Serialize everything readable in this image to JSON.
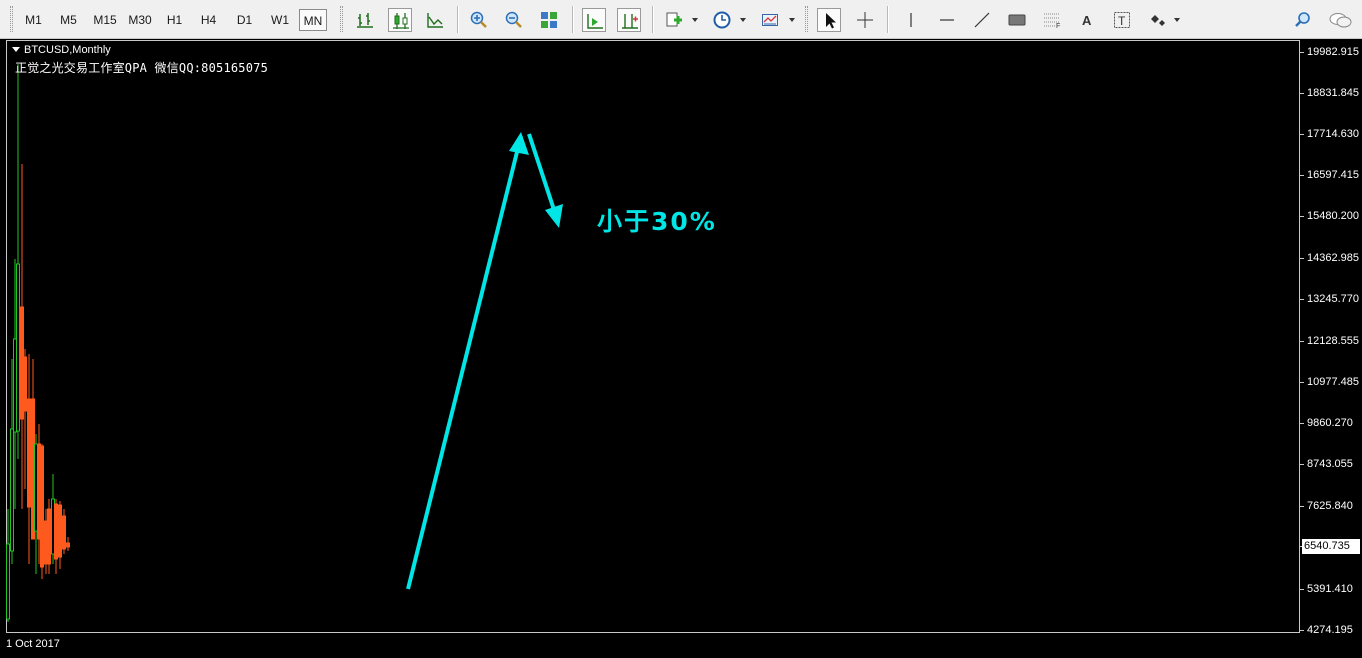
{
  "toolbar": {
    "timeframes": [
      "M1",
      "M5",
      "M15",
      "M30",
      "H1",
      "H4",
      "D1",
      "W1",
      "MN"
    ],
    "active_timeframe": "MN",
    "icons": {
      "bar_chart": "bar-chart-icon",
      "candlesticks": "candlestick-chart-icon",
      "line_chart": "line-chart-icon",
      "zoom_in": "zoom-in-icon",
      "zoom_out": "zoom-out-icon",
      "tile_windows": "tile-windows-icon",
      "auto_scroll": "auto-scroll-icon",
      "chart_shift": "chart-shift-icon",
      "indicators": "indicators-icon",
      "periodicity": "clock-icon",
      "templates": "templates-icon",
      "cursor": "cursor-icon",
      "crosshair": "crosshair-icon",
      "vertical_line": "vertical-line-icon",
      "horizontal_line": "horizontal-line-icon",
      "trendline": "trendline-icon",
      "rectangle": "rectangle-icon",
      "fibonacci": "fibonacci-icon",
      "text": "text-icon",
      "text_label": "text-label-icon",
      "arrows": "arrows-icon",
      "search": "search-icon",
      "chat": "chat-icon"
    },
    "text_tool_label": "A",
    "text_label_tool_label": "T"
  },
  "chart": {
    "title": "BTCUSD,Monthly",
    "indicator_text": "正觉之光交易工作室QPA 微信QQ:805165075",
    "annotation": "小于30%",
    "date_label": "1 Oct 2017",
    "current_price": "6540.735",
    "price_labels": [
      "19982.915",
      "18831.845",
      "17714.630",
      "16597.415",
      "15480.200",
      "14362.985",
      "13245.770",
      "12128.555",
      "10977.485",
      "9860.270",
      "8743.055",
      "7625.840",
      "5391.410",
      "4274.195"
    ],
    "colors": {
      "background": "#000000",
      "up_candle": "#22c522",
      "down_candle": "#ff5a1e",
      "annotation": "#00e5e5",
      "axis": "#c8c8c8"
    }
  }
}
